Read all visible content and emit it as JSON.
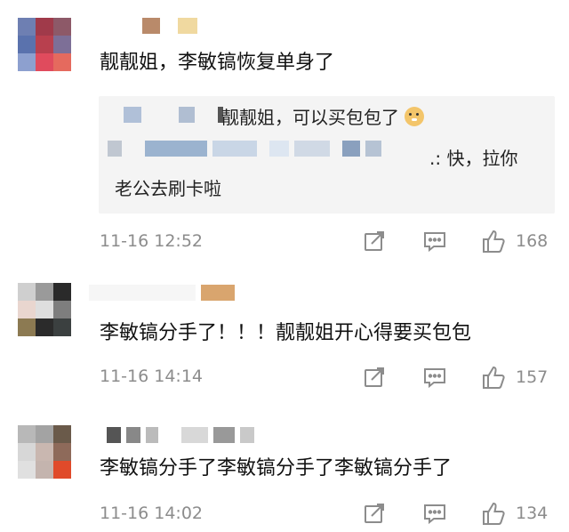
{
  "comments": [
    {
      "text": "靓靓姐，李敏镐恢复单身了",
      "quote": {
        "line1": "靓靓姐，可以买包包了",
        "emoji": "dog-face-emoji",
        "line2": ".: 快，拉你",
        "line3": "老公去刷卡啦"
      },
      "time": "11-16 12:52",
      "likes": "168"
    },
    {
      "text": "李敏镐分手了！！！靓靓姐开心得要买包包",
      "time": "11-16 14:14",
      "likes": "157"
    },
    {
      "text": "李敏镐分手了李敏镐分手了李敏镐分手了",
      "time": "11-16 14:02",
      "likes": "134"
    }
  ],
  "icons": {
    "share": "share-icon",
    "comment": "comment-icon",
    "like": "thumbs-up-icon"
  },
  "colors": {
    "meta": "#8c8c8c",
    "quote_bg": "#f4f4f4"
  }
}
